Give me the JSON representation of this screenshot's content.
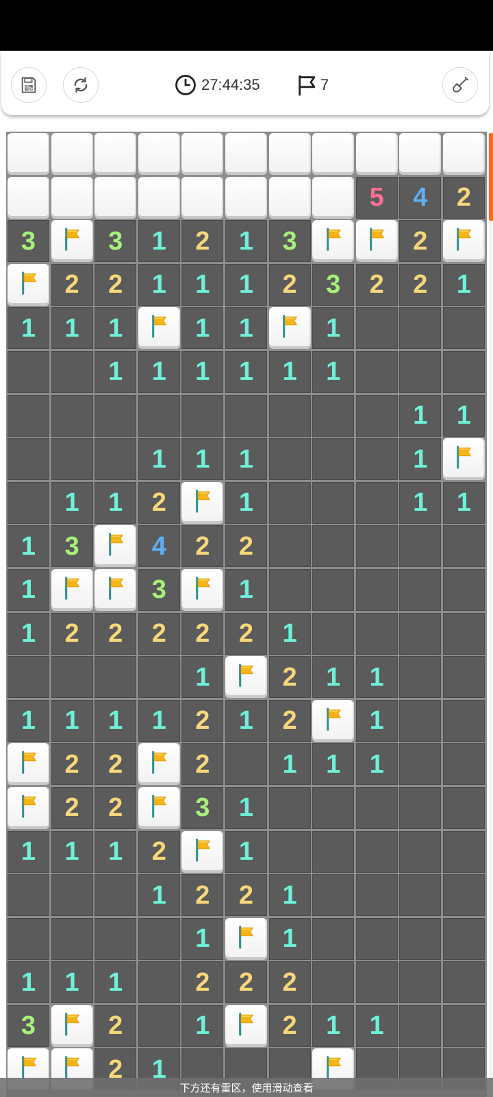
{
  "toolbar": {
    "save_icon": "save-icon",
    "restart_icon": "restart-icon",
    "timer_icon": "clock-icon",
    "timer": "27:44:35",
    "flags_icon": "flag-icon",
    "flag_count": "7",
    "dig_icon": "shovel-icon"
  },
  "board": {
    "columns": 11,
    "legend": {
      "h": "hidden",
      "o": "open",
      "f": "flag",
      "1-5": "number"
    },
    "rows": [
      [
        "h",
        "h",
        "h",
        "h",
        "h",
        "h",
        "h",
        "h",
        "h",
        "h",
        "h"
      ],
      [
        "h",
        "h",
        "h",
        "h",
        "h",
        "h",
        "h",
        "h",
        "5",
        "4",
        "2"
      ],
      [
        "3",
        "f",
        "3",
        "1",
        "2",
        "1",
        "3",
        "f",
        "f",
        "2",
        "f"
      ],
      [
        "f",
        "2",
        "2",
        "1",
        "1",
        "1",
        "2",
        "3",
        "2",
        "2",
        "1"
      ],
      [
        "1",
        "1",
        "1",
        "f",
        "1",
        "1",
        "f",
        "1",
        "o",
        "o",
        "o"
      ],
      [
        "o",
        "o",
        "1",
        "1",
        "1",
        "1",
        "1",
        "1",
        "o",
        "o",
        "o"
      ],
      [
        "o",
        "o",
        "o",
        "o",
        "o",
        "o",
        "o",
        "o",
        "o",
        "1",
        "1"
      ],
      [
        "o",
        "o",
        "o",
        "1",
        "1",
        "1",
        "o",
        "o",
        "o",
        "1",
        "f"
      ],
      [
        "o",
        "1",
        "1",
        "2",
        "f",
        "1",
        "o",
        "o",
        "o",
        "1",
        "1"
      ],
      [
        "1",
        "3",
        "f",
        "4",
        "2",
        "2",
        "o",
        "o",
        "o",
        "o",
        "o"
      ],
      [
        "1",
        "f",
        "f",
        "3",
        "f",
        "1",
        "o",
        "o",
        "o",
        "o",
        "o"
      ],
      [
        "1",
        "2",
        "2",
        "2",
        "2",
        "2",
        "1",
        "o",
        "o",
        "o",
        "o"
      ],
      [
        "o",
        "o",
        "o",
        "o",
        "1",
        "f",
        "2",
        "1",
        "1",
        "o",
        "o"
      ],
      [
        "1",
        "1",
        "1",
        "1",
        "2",
        "1",
        "2",
        "f",
        "1",
        "o",
        "o"
      ],
      [
        "f",
        "2",
        "2",
        "f",
        "2",
        "o",
        "1",
        "1",
        "1",
        "o",
        "o"
      ],
      [
        "f",
        "2",
        "2",
        "f",
        "3",
        "1",
        "o",
        "o",
        "o",
        "o",
        "o"
      ],
      [
        "1",
        "1",
        "1",
        "2",
        "f",
        "1",
        "o",
        "o",
        "o",
        "o",
        "o"
      ],
      [
        "o",
        "o",
        "o",
        "1",
        "2",
        "2",
        "1",
        "o",
        "o",
        "o",
        "o"
      ],
      [
        "o",
        "o",
        "o",
        "o",
        "1",
        "f",
        "1",
        "o",
        "o",
        "o",
        "o"
      ],
      [
        "1",
        "1",
        "1",
        "o",
        "2",
        "2",
        "2",
        "o",
        "o",
        "o",
        "o"
      ],
      [
        "3",
        "f",
        "2",
        "o",
        "1",
        "f",
        "2",
        "1",
        "1",
        "o",
        "o"
      ],
      [
        "f",
        "f",
        "2",
        "1",
        "o",
        "o",
        "o",
        "f",
        "o",
        "o",
        "o"
      ]
    ]
  },
  "hint": "下方还有雷区，使用滑动查看"
}
